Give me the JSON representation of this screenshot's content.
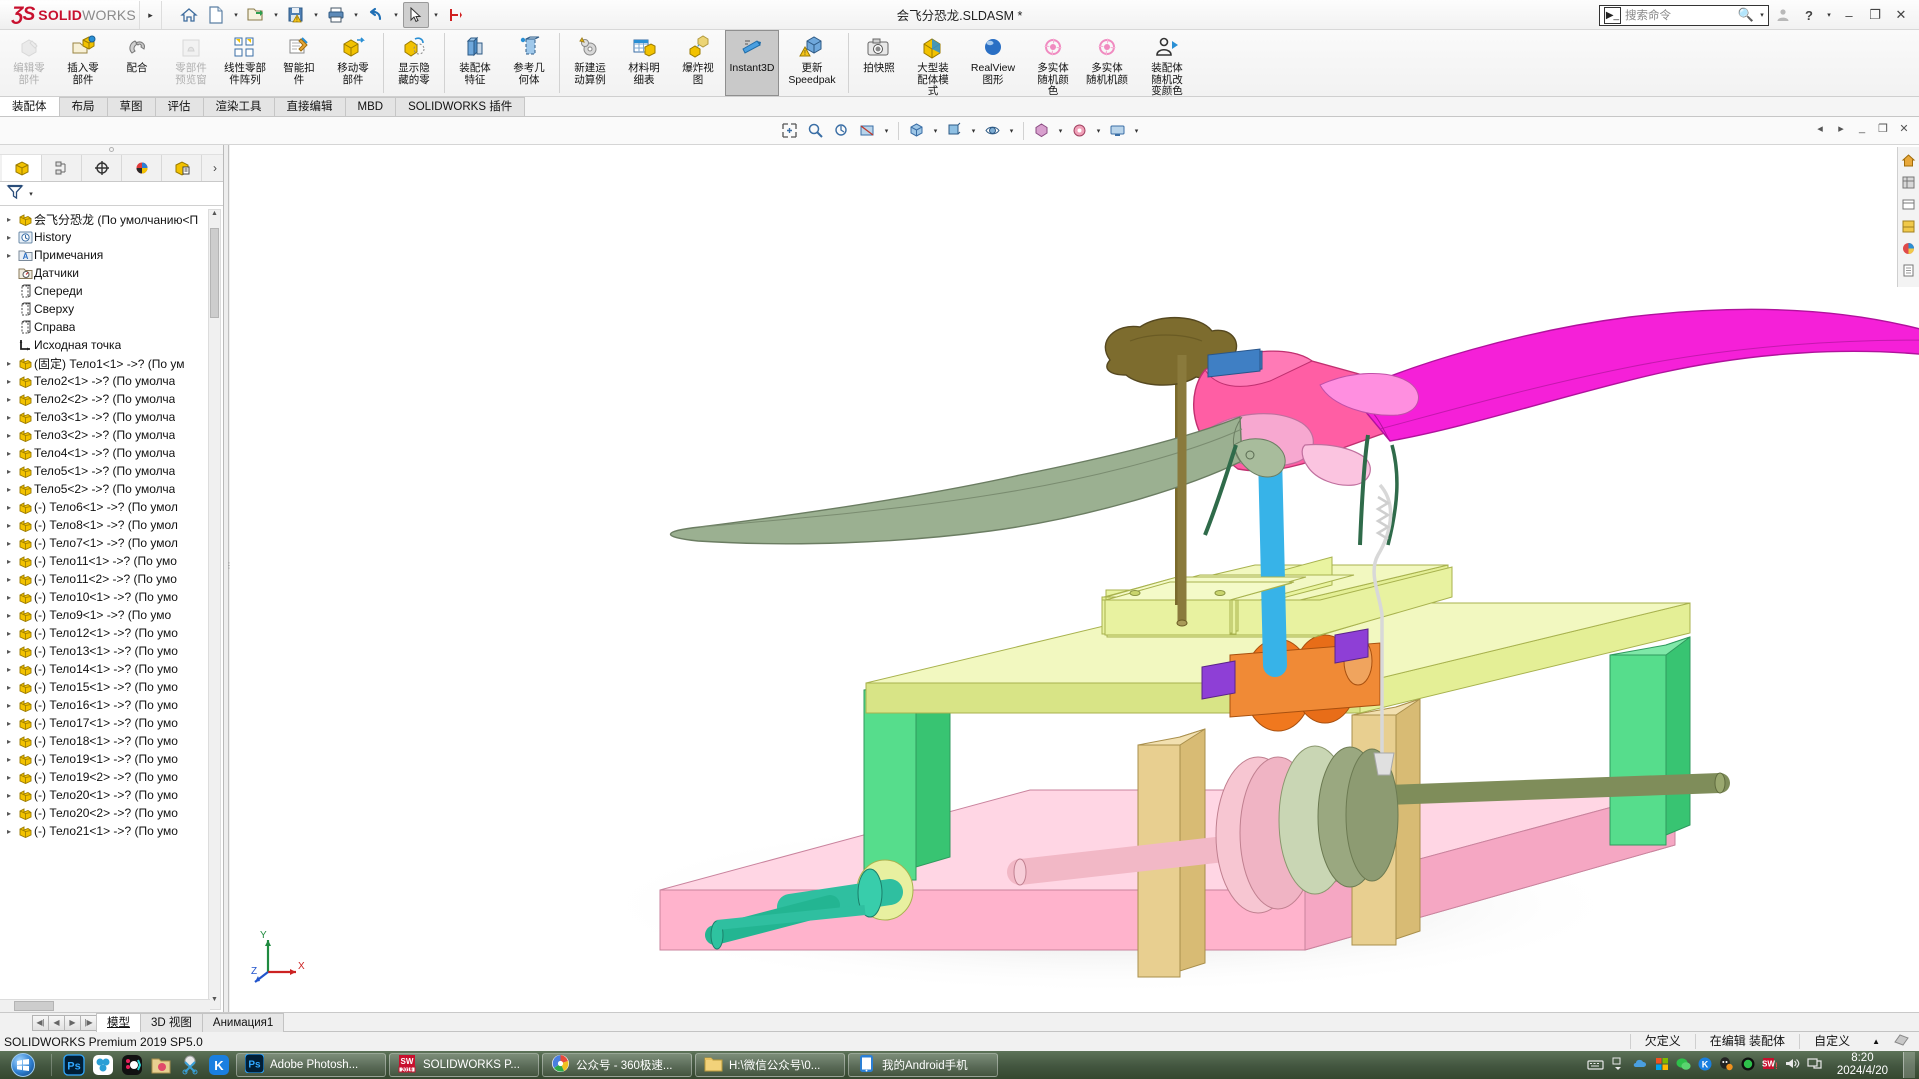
{
  "titlebar": {
    "logo_ds": "ƷS",
    "logo_solid": "SOLID",
    "logo_works": "WORKS",
    "document_title": "会飞分恐龙.SLDASM *",
    "quick_access": [
      {
        "name": "home-icon",
        "label": "主页"
      },
      {
        "name": "new-document-icon",
        "label": "新建"
      },
      {
        "name": "open-document-icon",
        "label": "打开"
      },
      {
        "name": "save-icon",
        "label": "保存"
      },
      {
        "name": "print-icon",
        "label": "打印"
      },
      {
        "name": "undo-icon",
        "label": "撤销"
      },
      {
        "name": "select-icon",
        "label": "选择"
      },
      {
        "name": "rebuild-icon",
        "label": "重建模型"
      },
      {
        "name": "options-icon",
        "label": "选项"
      }
    ],
    "search_placeholder": "搜索命令",
    "window_minimize": "–",
    "window_restore": "❐",
    "window_close": "✕",
    "help_label": "?"
  },
  "ribbon": {
    "commands": [
      {
        "label": "编辑零\n部件",
        "icon": "edit-component-icon",
        "state": "disabled"
      },
      {
        "label": "插入零\n部件",
        "icon": "insert-component-icon",
        "state": "normal"
      },
      {
        "label": "配合",
        "icon": "mate-icon",
        "state": "normal"
      },
      {
        "label": "零部件\n预览窗",
        "icon": "component-preview-icon",
        "state": "disabled"
      },
      {
        "label": "线性零部\n件阵列",
        "icon": "linear-pattern-icon",
        "state": "normal"
      },
      {
        "label": "智能扣\n件",
        "icon": "smart-fastener-icon",
        "state": "normal"
      },
      {
        "label": "移动零\n部件",
        "icon": "move-component-icon",
        "state": "normal"
      },
      {
        "sep": true
      },
      {
        "label": "显示隐\n藏的零",
        "icon": "show-hidden-components-icon",
        "state": "normal"
      },
      {
        "sep": true
      },
      {
        "label": "装配体\n特征",
        "icon": "assembly-features-icon",
        "state": "normal"
      },
      {
        "label": "参考几\n何体",
        "icon": "reference-geometry-icon",
        "state": "normal"
      },
      {
        "sep": true
      },
      {
        "label": "新建运\n动算例",
        "icon": "new-motion-study-icon",
        "state": "normal"
      },
      {
        "label": "材料明\n细表",
        "icon": "bill-of-materials-icon",
        "state": "normal"
      },
      {
        "label": "爆炸视\n图",
        "icon": "exploded-view-icon",
        "state": "normal"
      },
      {
        "label": "Instant3D",
        "icon": "instant3d-icon",
        "state": "selected"
      },
      {
        "label": "更新\nSpeedpak",
        "icon": "update-speedpak-icon",
        "state": "normal"
      },
      {
        "sep": true
      },
      {
        "label": "拍快照",
        "icon": "snapshot-icon",
        "state": "normal"
      },
      {
        "label": "大型装\n配体模\n式",
        "icon": "large-assembly-mode-icon",
        "state": "normal"
      },
      {
        "label": "RealView\n图形",
        "icon": "realview-graphics-icon",
        "state": "normal"
      },
      {
        "label": "多实体\n随机颜\n色",
        "icon": "multibody-random-color-icon",
        "state": "normal"
      },
      {
        "label": "多实体\n随机机颜",
        "icon": "multibody-random-color-2-icon",
        "state": "normal"
      },
      {
        "label": "装配体\n随机改\n变颜色",
        "icon": "assembly-random-color-icon",
        "state": "normal"
      }
    ]
  },
  "tabs": {
    "items": [
      {
        "label": "装配体",
        "active": true
      },
      {
        "label": "布局",
        "active": false
      },
      {
        "label": "草图",
        "active": false
      },
      {
        "label": "评估",
        "active": false
      },
      {
        "label": "渲染工具",
        "active": false
      },
      {
        "label": "直接编辑",
        "active": false
      },
      {
        "label": "MBD",
        "active": false
      },
      {
        "label": "SOLIDWORKS 插件",
        "active": false
      }
    ]
  },
  "viewbar": {
    "buttons": [
      {
        "name": "zoom-to-fit-icon"
      },
      {
        "name": "zoom-area-icon"
      },
      {
        "name": "previous-view-icon"
      },
      {
        "name": "section-view-icon"
      },
      {
        "name": "view-orientation-icon"
      },
      {
        "name": "display-style-icon"
      },
      {
        "name": "hide-show-items-icon"
      },
      {
        "name": "edit-appearance-icon"
      },
      {
        "name": "apply-scene-icon"
      },
      {
        "name": "view-settings-icon"
      }
    ]
  },
  "feature_manager": {
    "tabs": [
      {
        "name": "feature-manager-tab",
        "active": true
      },
      {
        "name": "property-manager-tab",
        "active": false
      },
      {
        "name": "configuration-manager-tab",
        "active": false
      },
      {
        "name": "display-manager-tab",
        "active": false
      },
      {
        "name": "dimxpert-manager-tab",
        "active": false
      }
    ],
    "filter_icon": "filter-icon",
    "more_icon": "chevron-right-icon",
    "root": "会飞分恐龙  (По умолчанию<П",
    "tree": [
      {
        "label": "History",
        "icon": "history-icon",
        "expandable": true
      },
      {
        "label": "Примечания",
        "icon": "annotations-icon",
        "expandable": true
      },
      {
        "label": "Датчики",
        "icon": "sensors-icon",
        "expandable": false
      },
      {
        "label": "Спереди",
        "icon": "plane-icon",
        "expandable": false
      },
      {
        "label": "Сверху",
        "icon": "plane-icon",
        "expandable": false
      },
      {
        "label": "Справа",
        "icon": "plane-icon",
        "expandable": false
      },
      {
        "label": "Исходная точка",
        "icon": "origin-icon",
        "expandable": false
      },
      {
        "label": "(固定) Тело1<1> ->? (По ум",
        "icon": "part-icon",
        "expandable": true
      },
      {
        "label": "Тело2<1> ->? (По умолча",
        "icon": "part-icon",
        "expandable": true
      },
      {
        "label": "Тело2<2> ->? (По умолча",
        "icon": "part-icon",
        "expandable": true
      },
      {
        "label": "Тело3<1> ->? (По умолча",
        "icon": "part-icon",
        "expandable": true
      },
      {
        "label": "Тело3<2> ->? (По умолча",
        "icon": "part-icon",
        "expandable": true
      },
      {
        "label": "Тело4<1> ->? (По умолча",
        "icon": "part-icon",
        "expandable": true
      },
      {
        "label": "Тело5<1> ->? (По умолча",
        "icon": "part-icon",
        "expandable": true
      },
      {
        "label": "Тело5<2> ->? (По умолча",
        "icon": "part-icon",
        "expandable": true
      },
      {
        "label": "(-) Тело6<1> ->? (По умол",
        "icon": "part-icon",
        "expandable": true
      },
      {
        "label": "(-) Тело8<1> ->? (По умол",
        "icon": "part-icon",
        "expandable": true
      },
      {
        "label": "(-) Тело7<1> ->? (По умол",
        "icon": "part-icon",
        "expandable": true
      },
      {
        "label": "(-) Тело11<1> ->? (По умо",
        "icon": "part-icon",
        "expandable": true
      },
      {
        "label": "(-) Тело11<2> ->? (По умо",
        "icon": "part-icon",
        "expandable": true
      },
      {
        "label": "(-) Тело10<1> ->? (По умо",
        "icon": "part-icon",
        "expandable": true
      },
      {
        "label": "(-) Тело9<1> ->? (По умо",
        "icon": "part-icon",
        "expandable": true
      },
      {
        "label": "(-) Тело12<1> ->? (По умо",
        "icon": "part-icon",
        "expandable": true
      },
      {
        "label": "(-) Тело13<1> ->? (По умо",
        "icon": "part-icon",
        "expandable": true
      },
      {
        "label": "(-) Тело14<1> ->? (По умо",
        "icon": "part-icon",
        "expandable": true
      },
      {
        "label": "(-) Тело15<1> ->? (По умо",
        "icon": "part-icon",
        "expandable": true
      },
      {
        "label": "(-) Тело16<1> ->? (По умо",
        "icon": "part-icon",
        "expandable": true
      },
      {
        "label": "(-) Тело17<1> ->? (По умо",
        "icon": "part-icon",
        "expandable": true
      },
      {
        "label": "(-) Тело18<1> ->? (По умо",
        "icon": "part-icon",
        "expandable": true
      },
      {
        "label": "(-) Тело19<1> ->? (По умо",
        "icon": "part-icon",
        "expandable": true
      },
      {
        "label": "(-) Тело19<2> ->? (По умо",
        "icon": "part-icon",
        "expandable": true
      },
      {
        "label": "(-) Тело20<1> ->? (По умо",
        "icon": "part-icon",
        "expandable": true
      },
      {
        "label": "(-) Тело20<2> ->? (По умо",
        "icon": "part-icon",
        "expandable": true
      },
      {
        "label": "(-) Тело21<1> ->? (По умо",
        "icon": "part-icon",
        "expandable": true
      }
    ]
  },
  "bottom_tabs": {
    "items": [
      {
        "label": "模型",
        "active": true
      },
      {
        "label": "3D 视图",
        "active": false
      },
      {
        "label": "Анимация1",
        "active": false
      }
    ]
  },
  "statusbar": {
    "left": "SOLIDWORKS Premium 2019 SP5.0",
    "cells": [
      "欠定义",
      "在编辑 装配体",
      "自定义"
    ],
    "caret": "▲"
  },
  "taskbar": {
    "start_label": "开始",
    "quick_launch": [
      {
        "name": "photoshop-quick-icon",
        "label": "Ps"
      },
      {
        "name": "browser-quick-icon",
        "label": ""
      },
      {
        "name": "app-quick-icon",
        "label": ""
      },
      {
        "name": "folder-quick-icon",
        "label": ""
      },
      {
        "name": "snip-quick-icon",
        "label": ""
      },
      {
        "name": "kingsoft-quick-icon",
        "label": "K"
      }
    ],
    "tasks": [
      {
        "label": "Adobe Photosh...",
        "icon": "photoshop-icon",
        "icon_text": "Ps",
        "color": "#001e36",
        "active": false
      },
      {
        "label": "SOLIDWORKS P...",
        "icon": "solidworks-icon",
        "icon_text": "SW",
        "color": "#c8102e",
        "active": true
      },
      {
        "label": "公众号 - 360极速...",
        "icon": "browser-360-icon",
        "icon_text": "",
        "color": "#48a0e0",
        "active": false
      },
      {
        "label": "H:\\微信公众号\\0...",
        "icon": "explorer-folder-icon",
        "icon_text": "",
        "color": "#f0c060",
        "active": false
      },
      {
        "label": "我的Android手机",
        "icon": "android-phone-icon",
        "icon_text": "",
        "color": "#2b7fd4",
        "active": false
      }
    ],
    "tray": [
      {
        "name": "keyboard-tray-icon"
      },
      {
        "name": "show-hidden-tray-icon"
      },
      {
        "name": "cloud-tray-icon"
      },
      {
        "name": "windows-tray-icon"
      },
      {
        "name": "wechat-tray-icon"
      },
      {
        "name": "kingsoft-tray-icon"
      },
      {
        "name": "qq-tray-icon"
      },
      {
        "name": "green-circle-tray-icon"
      },
      {
        "name": "solidworks-tray-icon"
      },
      {
        "name": "volume-tray-icon"
      },
      {
        "name": "network-tray-icon"
      }
    ],
    "clock_time": "8:20",
    "clock_date": "2024/4/20"
  },
  "graphics": {
    "model_name": "会飞分恐龙",
    "triad_axes": [
      "X",
      "Y",
      "Z"
    ],
    "origin_marker": "┼",
    "colors": {
      "wing_magenta": "#f21fd6",
      "wing_green": "#8fa583",
      "body_pink": "#ff5fa0",
      "frame_green": "#55dd88",
      "table_cream": "#e6f0a8",
      "base_pink": "#ffb6cf",
      "post_tan": "#e3c98a",
      "shaft_olive": "#7f8a5a",
      "cam_orange": "#f07830",
      "shaft_blue": "#3fb5e8",
      "crank_teal": "#18a68a",
      "rod_pink": "#f0a8b8",
      "head_olive": "#7a6a2c"
    }
  },
  "right_dock": {
    "buttons": [
      {
        "name": "home-dock-icon"
      },
      {
        "name": "design-library-icon"
      },
      {
        "name": "file-explorer-dock-icon"
      },
      {
        "name": "view-palette-icon"
      },
      {
        "name": "appearances-dock-icon"
      },
      {
        "name": "custom-properties-icon"
      }
    ]
  }
}
